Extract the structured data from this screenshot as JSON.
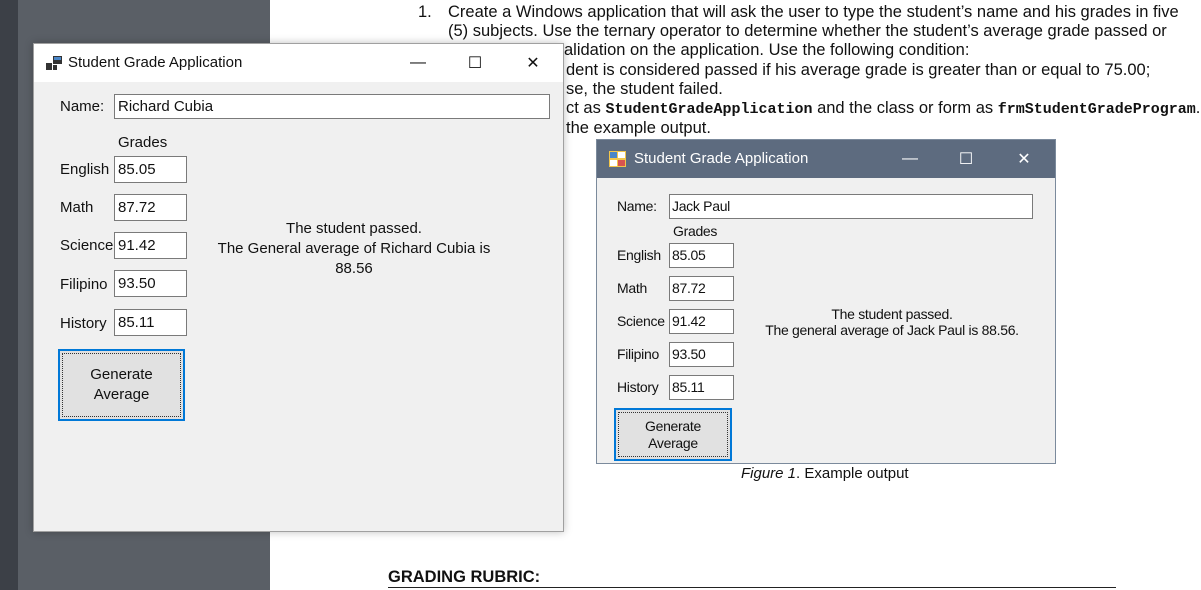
{
  "document": {
    "list_number": "1.",
    "lines": [
      "Create a Windows application that will ask the user to type the student’s name and his grades in five",
      "(5) subjects. Use the ternary operator to determine whether the student’s average grade passed or",
      "alidation on the application. Use the following condition:",
      "dent is considered passed if his average grade is greater than or equal to 75.00;",
      "se, the student failed."
    ],
    "project_line": {
      "prefix": "ct as ",
      "project_name": "StudentGradeApplication",
      "middle": " and the class or form as ",
      "form_name": "frmStudentGradeProgram",
      "suffix": "."
    },
    "example_line": "the example output.",
    "figure_caption_label": "Figure 1",
    "figure_caption_rest": ". Example output",
    "rubric_heading": "GRADING RUBRIC:"
  },
  "window": {
    "title": "Student Grade Application",
    "minimize_glyph": "—",
    "maximize_glyph": "☐",
    "close_glyph": "✕",
    "name_label": "Name:",
    "name_value": "Richard Cubia",
    "grades_header": "Grades",
    "subjects": [
      {
        "label": "English",
        "value": "85.05"
      },
      {
        "label": "Math",
        "value": "87.72"
      },
      {
        "label": "Science",
        "value": "91.42"
      },
      {
        "label": "Filipino",
        "value": "93.50"
      },
      {
        "label": "History",
        "value": "85.11"
      }
    ],
    "generate_line1": "Generate",
    "generate_line2": "Average",
    "result_line1": "The student passed.",
    "result_line2": "The General average of Richard Cubia is 88.56"
  },
  "figure_window": {
    "title": "Student Grade Application",
    "minimize_glyph": "—",
    "maximize_glyph": "☐",
    "close_glyph": "✕",
    "name_label": "Name:",
    "name_value": "Jack Paul",
    "grades_header": "Grades",
    "subjects": [
      {
        "label": "English",
        "value": "85.05"
      },
      {
        "label": "Math",
        "value": "87.72"
      },
      {
        "label": "Science",
        "value": "91.42"
      },
      {
        "label": "Filipino",
        "value": "93.50"
      },
      {
        "label": "History",
        "value": "85.11"
      }
    ],
    "generate_line1": "Generate",
    "generate_line2": "Average",
    "result_line1": "The student passed.",
    "result_line2": "The general average of Jack Paul is 88.56."
  },
  "colors": {
    "focus_border": "#0078d7",
    "figure_titlebar": "#5d6b7f",
    "gutter": "#5a5f66"
  }
}
